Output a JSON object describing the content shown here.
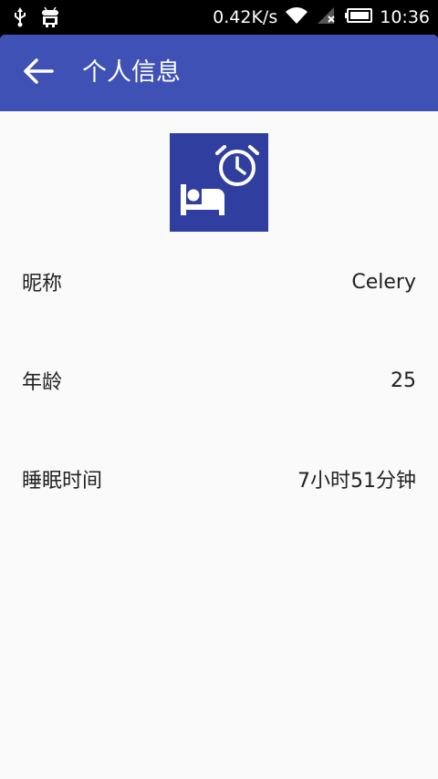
{
  "status_bar": {
    "net_speed": "0.42K/s",
    "time": "10:36",
    "left_icons": [
      "usb-icon",
      "android-debug-icon"
    ],
    "right_icons": [
      "wifi-icon",
      "signal-no-sim-icon",
      "battery-icon"
    ]
  },
  "toolbar": {
    "title": "个人信息",
    "back_icon": "arrow-back-icon",
    "color": "#3f51b5"
  },
  "avatar": {
    "icon": "sleep-alarm-icon",
    "color": "#303f9f"
  },
  "profile": {
    "nickname": {
      "label": "昵称",
      "value": "Celery"
    },
    "age": {
      "label": "年龄",
      "value": "25"
    },
    "sleep_time": {
      "label": "睡眠时间",
      "value": "7小时51分钟"
    }
  }
}
